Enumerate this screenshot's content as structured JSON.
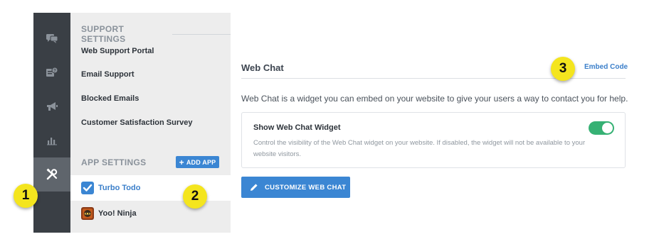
{
  "rail": {
    "items": [
      {
        "icon": "chat-bubbles-icon"
      },
      {
        "icon": "help-ticket-icon"
      },
      {
        "icon": "megaphone-icon"
      },
      {
        "icon": "bar-chart-icon"
      },
      {
        "icon": "tools-icon",
        "active": true
      }
    ]
  },
  "sidebar": {
    "support_heading": "SUPPORT SETTINGS",
    "support_items": [
      {
        "label": "Web Support Portal"
      },
      {
        "label": "Email Support"
      },
      {
        "label": "Blocked Emails"
      },
      {
        "label": "Customer Satisfaction Survey"
      }
    ],
    "app_heading": "APP SETTINGS",
    "add_app_plus": "+",
    "add_app_label": "ADD APP",
    "apps": [
      {
        "name": "Turbo Todo",
        "icon": "checkbox-app-icon",
        "active": true
      },
      {
        "name": "Yoo! Ninja",
        "icon": "ninja-app-icon"
      }
    ]
  },
  "main": {
    "title": "Web Chat",
    "embed_link": "Embed Code",
    "description": "Web Chat is a widget you can embed on your website to give your users a way to contact you for help.",
    "card": {
      "title": "Show Web Chat Widget",
      "description": "Control the visibility of the Web Chat widget on your website. If disabled, the widget will not be available to your website visitors.",
      "toggle_on": true
    },
    "customize_button": "CUSTOMIZE WEB CHAT"
  },
  "markers": [
    "1",
    "2",
    "3"
  ],
  "colors": {
    "accent": "#3b86d3",
    "toggle": "#36b174",
    "marker": "#f4e51e",
    "rail": "#3a3f45",
    "sidebar": "#ededed"
  }
}
